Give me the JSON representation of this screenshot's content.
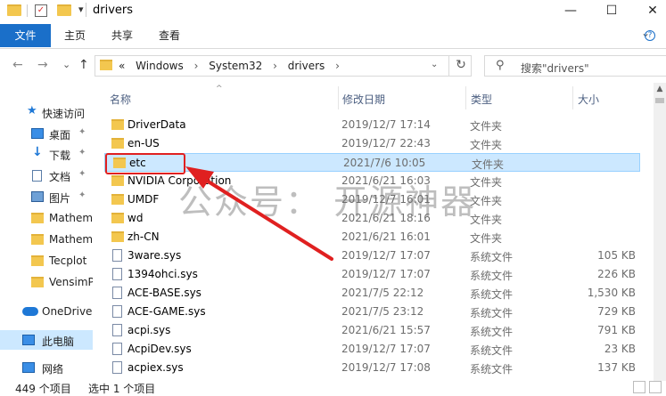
{
  "window": {
    "title": "drivers",
    "minimize": "—",
    "maximize": "☐",
    "close": "✕"
  },
  "quick_access_toolbar": {
    "dropdown": "▾"
  },
  "ribbon": {
    "tabs": [
      "文件",
      "主页",
      "共享",
      "查看"
    ],
    "expand": "⌄",
    "help": "?"
  },
  "navigation": {
    "back": "←",
    "forward": "→",
    "recent": "⌄",
    "up": "↑"
  },
  "address_bar": {
    "overflow": "«",
    "path": [
      "Windows",
      "System32",
      "drivers"
    ],
    "separator": "›",
    "dropdown": "⌄",
    "refresh": "↻"
  },
  "search": {
    "placeholder": "搜索\"drivers\""
  },
  "nav_pane": {
    "quick_access_label": "快速访问",
    "items": [
      {
        "label": "桌面",
        "icon": "desktop-icon",
        "pinned": true
      },
      {
        "label": "下载",
        "icon": "download-icon",
        "pinned": true
      },
      {
        "label": "文档",
        "icon": "document-icon",
        "pinned": true
      },
      {
        "label": "图片",
        "icon": "picture-icon",
        "pinned": true
      },
      {
        "label": "Mathem",
        "icon": "folder-icon",
        "pinned": false
      },
      {
        "label": "Mathem",
        "icon": "folder-icon",
        "pinned": false
      },
      {
        "label": "Tecplot",
        "icon": "folder-icon",
        "pinned": false
      },
      {
        "label": "VensimP",
        "icon": "folder-icon",
        "pinned": false
      }
    ],
    "onedrive_label": "OneDrive",
    "this_pc_label": "此电脑",
    "network_label": "网络",
    "pin_glyph": "📌"
  },
  "columns": {
    "name": "名称",
    "date": "修改日期",
    "type": "类型",
    "size": "大小",
    "sort_glyph": "^"
  },
  "files": [
    {
      "name": "DriverData",
      "date": "2019/12/7 17:14",
      "type": "文件夹",
      "size": "",
      "kind": "folder"
    },
    {
      "name": "en-US",
      "date": "2019/12/7 22:43",
      "type": "文件夹",
      "size": "",
      "kind": "folder"
    },
    {
      "name": "etc",
      "date": "2021/7/6 10:05",
      "type": "文件夹",
      "size": "",
      "kind": "folder",
      "selected": true
    },
    {
      "name": "NVIDIA Corporation",
      "date": "2021/6/21 16:03",
      "type": "文件夹",
      "size": "",
      "kind": "folder"
    },
    {
      "name": "UMDF",
      "date": "2019/12/7 16:01",
      "type": "文件夹",
      "size": "",
      "kind": "folder"
    },
    {
      "name": "wd",
      "date": "2021/6/21 18:16",
      "type": "文件夹",
      "size": "",
      "kind": "folder"
    },
    {
      "name": "zh-CN",
      "date": "2021/6/21 16:01",
      "type": "文件夹",
      "size": "",
      "kind": "folder"
    },
    {
      "name": "3ware.sys",
      "date": "2019/12/7 17:07",
      "type": "系统文件",
      "size": "105 KB",
      "kind": "sys"
    },
    {
      "name": "1394ohci.sys",
      "date": "2019/12/7 17:07",
      "type": "系统文件",
      "size": "226 KB",
      "kind": "sys"
    },
    {
      "name": "ACE-BASE.sys",
      "date": "2021/7/5 22:12",
      "type": "系统文件",
      "size": "1,530 KB",
      "kind": "sys"
    },
    {
      "name": "ACE-GAME.sys",
      "date": "2021/7/5 23:12",
      "type": "系统文件",
      "size": "729 KB",
      "kind": "sys"
    },
    {
      "name": "acpi.sys",
      "date": "2021/6/21 15:57",
      "type": "系统文件",
      "size": "791 KB",
      "kind": "sys"
    },
    {
      "name": "AcpiDev.sys",
      "date": "2019/12/7 17:07",
      "type": "系统文件",
      "size": "23 KB",
      "kind": "sys"
    },
    {
      "name": "acpiex.sys",
      "date": "2019/12/7 17:08",
      "type": "系统文件",
      "size": "137 KB",
      "kind": "sys"
    }
  ],
  "status_bar": {
    "item_count": "449 个项目",
    "selected": "选中 1 个项目"
  },
  "watermark": "公众号：  开源神器",
  "colors": {
    "accent": "#1a6fc9",
    "selection": "#cce8ff",
    "annotation": "#e02020"
  }
}
